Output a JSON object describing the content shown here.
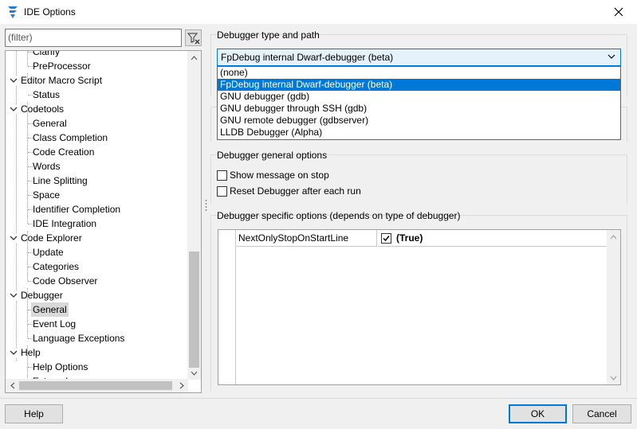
{
  "window": {
    "title": "IDE Options"
  },
  "filter": {
    "placeholder": "(filter)",
    "value": "(filter)"
  },
  "tree": {
    "items": [
      {
        "label": "Clarify",
        "level": 1
      },
      {
        "label": "PreProcessor",
        "level": 1
      },
      {
        "label": "Editor Macro Script",
        "level": 0,
        "expanded": true
      },
      {
        "label": "Status",
        "level": 1
      },
      {
        "label": "Codetools",
        "level": 0,
        "expanded": true
      },
      {
        "label": "General",
        "level": 1
      },
      {
        "label": "Class Completion",
        "level": 1
      },
      {
        "label": "Code Creation",
        "level": 1
      },
      {
        "label": "Words",
        "level": 1
      },
      {
        "label": "Line Splitting",
        "level": 1
      },
      {
        "label": "Space",
        "level": 1
      },
      {
        "label": "Identifier Completion",
        "level": 1
      },
      {
        "label": "IDE Integration",
        "level": 1
      },
      {
        "label": "Code Explorer",
        "level": 0,
        "expanded": true
      },
      {
        "label": "Update",
        "level": 1
      },
      {
        "label": "Categories",
        "level": 1
      },
      {
        "label": "Code Observer",
        "level": 1
      },
      {
        "label": "Debugger",
        "level": 0,
        "expanded": true
      },
      {
        "label": "General",
        "level": 1,
        "selected": true
      },
      {
        "label": "Event Log",
        "level": 1
      },
      {
        "label": "Language Exceptions",
        "level": 1
      },
      {
        "label": "Help",
        "level": 0,
        "expanded": true
      },
      {
        "label": "Help Options",
        "level": 1
      },
      {
        "label": "External",
        "level": 1
      }
    ]
  },
  "debugger_type": {
    "group_title": "Debugger type and path",
    "selected": "FpDebug internal Dwarf-debugger (beta)",
    "options": [
      "(none)",
      "FpDebug internal Dwarf-debugger (beta)",
      "GNU debugger (gdb)",
      "GNU debugger through SSH (gdb)",
      "GNU remote debugger (gdbserver)",
      "LLDB Debugger (Alpha)"
    ],
    "highlighted_index": 1
  },
  "general_options": {
    "group_title": "Debugger general options",
    "show_message_label": "Show message on stop",
    "show_message_checked": false,
    "reset_label": "Reset Debugger after each run",
    "reset_checked": false
  },
  "specific_options": {
    "group_title": "Debugger specific options (depends on type of debugger)",
    "rows": [
      {
        "name": "NextOnlyStopOnStartLine",
        "value": "(True)",
        "checked": true
      }
    ]
  },
  "buttons": {
    "help": "Help",
    "ok": "OK",
    "cancel": "Cancel"
  },
  "colors": {
    "accent": "#0078d7",
    "selection": "#0078d7",
    "tree_selected": "#d9d9d9"
  }
}
